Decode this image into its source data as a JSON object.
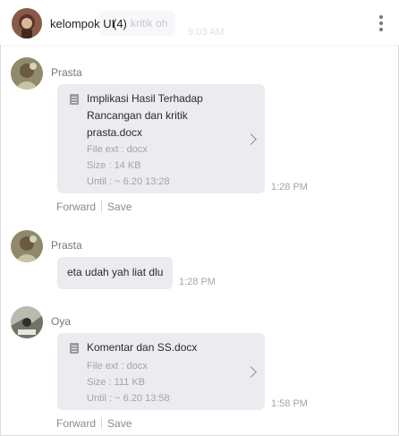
{
  "header": {
    "title": "kelompok UI",
    "count": "(4)",
    "ghost_text": "kritik oh",
    "ghost_time": "9:03 AM"
  },
  "messages": [
    {
      "sender": "Prasta",
      "file_name_lines": [
        "Implikasi Hasil Terhadap",
        "Rancangan dan kritik",
        "prasta.docx"
      ],
      "file_ext": "File ext : docx",
      "file_size": "Size : 14 KB",
      "until": "Until : ~ 6.20 13:28",
      "time": "1:28 PM",
      "forward": "Forward",
      "save": "Save"
    },
    {
      "sender": "Prasta",
      "text": "eta udah yah liat dlu",
      "time": "1:28 PM"
    },
    {
      "sender": "Oya",
      "file_name_lines": [
        "Komentar dan SS.docx"
      ],
      "file_ext": "File ext : docx",
      "file_size": "Size : 111 KB",
      "until": "Until : ~ 6.20 13:58",
      "time": "1:58 PM",
      "forward": "Forward",
      "save": "Save"
    }
  ],
  "icons": {
    "file": "document-icon",
    "chevron": "chevron-right-icon",
    "menu": "kebab-menu-icon"
  },
  "colors": {
    "bubble": "#ebebf0",
    "muted_text": "#a3a3a8",
    "header_avatar": "#7a4a3a"
  }
}
